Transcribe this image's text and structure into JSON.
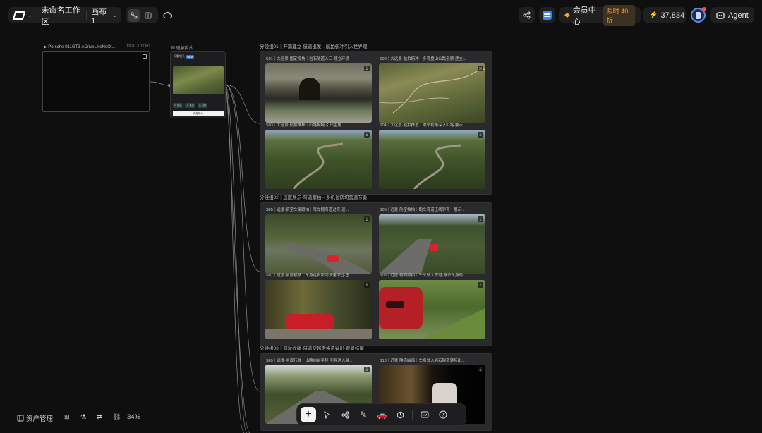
{
  "topbar": {
    "workspace_name": "未命名工作区",
    "canvas_name": "画布 1",
    "member_center": "会员中心",
    "member_badge": "限时 40 折",
    "credits": "37,834",
    "agent_label": "Agent"
  },
  "canvas": {
    "video_node": {
      "title": "Porsche-911GT3-ADriveLikeNoOt...",
      "dims": "1920 × 1080"
    },
    "storyboard_node": {
      "title": "逐帧拆片",
      "inner_tag": "拆解镜头",
      "inner_badge": "NEW",
      "button": "开始拆片",
      "chips": [
        "片 镜头",
        "片 场景",
        "片 分镜"
      ]
    },
    "groups": [
      {
        "title": "分镜组01｜开篇建立·隧道出发→航拍俯冲引入世界观",
        "shots": [
          {
            "caption": "S01｜大远景·固定视角｜岩石隧道入口·建立环境"
          },
          {
            "caption": "S02｜大远景·航拍俯冲｜多弯盘山公路全貌·建立..."
          },
          {
            "caption": "S03｜大远景·航拍推移｜山路蜿蜒·引出主角"
          },
          {
            "caption": "S04｜大远景·航拍推进｜跟车视角深入山路·展示..."
          }
        ]
      },
      {
        "title": "分镜组02｜速度展示·弯道跟拍→多机位快切营造节奏",
        "shots": [
          {
            "caption": "S05｜远景·俯空车尾跟拍｜弯车随弯道过弯·速..."
          },
          {
            "caption": "S06｜远景·航空推拍｜跑车弯道压线转弯｜展示..."
          },
          {
            "caption": "S07｜近景·前景横移｜车身在树影间快速掠过·压..."
          },
          {
            "caption": "S08｜近景·侧面跟拍｜车头驶入弯道·展示车身动..."
          }
        ]
      },
      {
        "title": "分镜组03｜驾驶收尾·隧道穿越定格悬疑出·背景结尾",
        "shots": [
          {
            "caption": "S09｜远景·主观行驶｜山路向前平移·引导进入隧..."
          },
          {
            "caption": "S10｜近景·隧道幽暗｜车身驶入岩石隧道转场出..."
          }
        ]
      }
    ]
  },
  "bottom_left": {
    "asset_label": "资产管理",
    "zoom": "34%"
  },
  "icons": {
    "logo": "logo-icon",
    "connect": "connect-icon",
    "layout": "layout-icon",
    "cloud": "cloud-sync-icon",
    "share": "share-icon",
    "layers": "layers-icon",
    "diamond": "diamond-icon",
    "bolt": "bolt-icon",
    "agent": "agent-icon"
  },
  "colors": {
    "accent_orange": "#f2a33a",
    "accent_blue": "#3b82f6",
    "bg": "#0f0f10"
  }
}
